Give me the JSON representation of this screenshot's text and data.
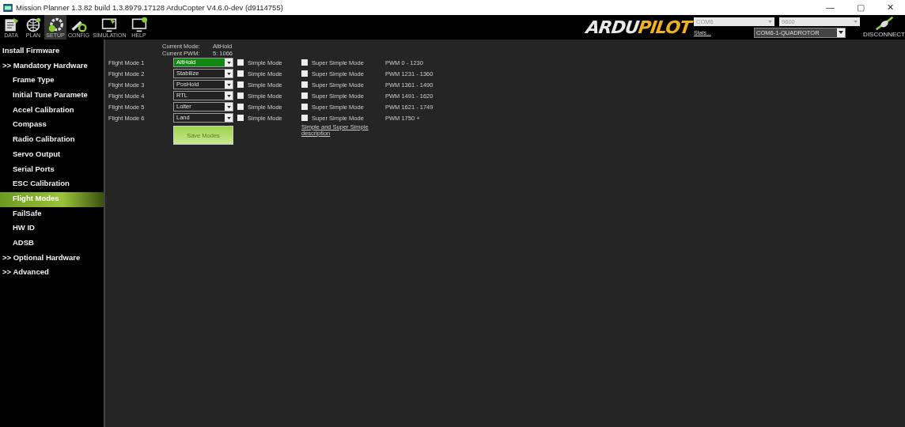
{
  "window": {
    "title": "Mission Planner 1.3.82 build 1.3.8979.17128 ArduCopter V4.6.0-dev (d9114755)",
    "controls": [
      "—",
      "▢",
      "✕"
    ]
  },
  "toolbar": {
    "buttons": [
      {
        "label": "DATA",
        "kind": "data",
        "selected": false
      },
      {
        "label": "PLAN",
        "kind": "plan",
        "selected": false
      },
      {
        "label": "SETUP",
        "kind": "setup",
        "selected": true
      },
      {
        "label": "CONFIG",
        "kind": "config",
        "selected": false
      },
      {
        "label": "SIMULATION",
        "kind": "simulation",
        "selected": false
      },
      {
        "label": "HELP",
        "kind": "help",
        "selected": false
      }
    ],
    "logo": {
      "part1": "ARDU",
      "part2": "PILOT"
    },
    "port": "COM6",
    "baud": "9600",
    "stats": "Stats...",
    "vehicle": "COM6-1-QUADROTOR",
    "connect": "DISCONNECT"
  },
  "sidebar": {
    "items": [
      {
        "label": "Install Firmware",
        "kind": "top",
        "selected": false
      },
      {
        "label": ">> Mandatory Hardware",
        "kind": "top",
        "selected": false
      },
      {
        "label": "Frame Type",
        "kind": "sub",
        "selected": false
      },
      {
        "label": "Initial Tune Paramete",
        "kind": "sub",
        "selected": false
      },
      {
        "label": "Accel Calibration",
        "kind": "sub",
        "selected": false
      },
      {
        "label": "Compass",
        "kind": "sub",
        "selected": false
      },
      {
        "label": "Radio Calibration",
        "kind": "sub",
        "selected": false
      },
      {
        "label": "Servo Output",
        "kind": "sub",
        "selected": false
      },
      {
        "label": "Serial Ports",
        "kind": "sub",
        "selected": false
      },
      {
        "label": "ESC Calibration",
        "kind": "sub",
        "selected": false
      },
      {
        "label": "Flight Modes",
        "kind": "sub",
        "selected": true
      },
      {
        "label": "FailSafe",
        "kind": "sub",
        "selected": false
      },
      {
        "label": "HW ID",
        "kind": "sub",
        "selected": false
      },
      {
        "label": "ADSB",
        "kind": "sub",
        "selected": false
      },
      {
        "label": ">> Optional Hardware",
        "kind": "top",
        "selected": false
      },
      {
        "label": ">> Advanced",
        "kind": "top",
        "selected": false
      }
    ]
  },
  "status": {
    "mode_label": "Current Mode:",
    "mode": "AltHold",
    "pwm_label": "Current PWM:",
    "pwm": "5: 1066"
  },
  "flight_modes": [
    {
      "label": "Flight Mode 1",
      "mode": "AltHold",
      "active": true,
      "simple": "Simple Mode",
      "simple_checked": false,
      "super_simple": "Super Simple Mode",
      "super_simple_checked": false,
      "pwm": "PWM 0 - 1230"
    },
    {
      "label": "Flight Mode 2",
      "mode": "Stabilize",
      "active": false,
      "simple": "Simple Mode",
      "simple_checked": false,
      "super_simple": "Super Simple Mode",
      "super_simple_checked": false,
      "pwm": "PWM 1231 - 1360"
    },
    {
      "label": "Flight Mode 3",
      "mode": "PosHold",
      "active": false,
      "simple": "Simple Mode",
      "simple_checked": false,
      "super_simple": "Super Simple Mode",
      "super_simple_checked": false,
      "pwm": "PWM 1361 - 1490"
    },
    {
      "label": "Flight Mode 4",
      "mode": "RTL",
      "active": false,
      "simple": "Simple Mode",
      "simple_checked": false,
      "super_simple": "Super Simple Mode",
      "super_simple_checked": false,
      "pwm": "PWM 1491 - 1620"
    },
    {
      "label": "Flight Mode 5",
      "mode": "Loiter",
      "active": false,
      "simple": "Simple Mode",
      "simple_checked": false,
      "super_simple": "Super Simple Mode",
      "super_simple_checked": false,
      "pwm": "PWM 1621 - 1749"
    },
    {
      "label": "Flight Mode 6",
      "mode": "Land",
      "active": false,
      "simple": "Simple Mode",
      "simple_checked": false,
      "super_simple": "Super Simple Mode",
      "super_simple_checked": false,
      "pwm": "PWM 1750 +"
    }
  ],
  "save_button": "Save Modes",
  "description_link": "Simple and Super Simple description"
}
